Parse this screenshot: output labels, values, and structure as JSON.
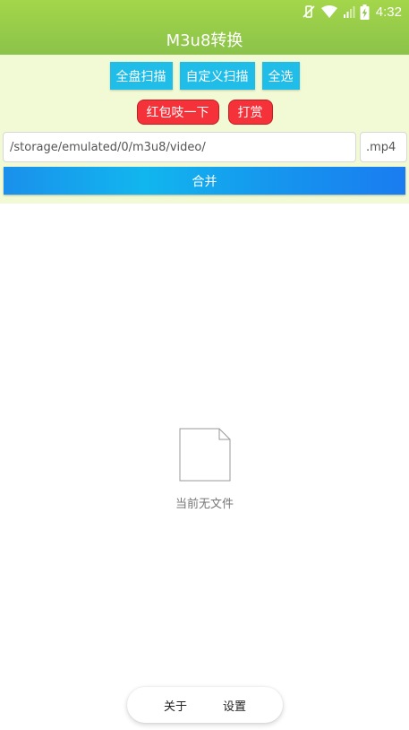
{
  "status_bar": {
    "time": "4:32",
    "icons": [
      "mute-vibrate-icon",
      "wifi-icon",
      "signal-icon",
      "battery-charging-icon"
    ]
  },
  "app": {
    "title": "M3u8转换"
  },
  "toolbar": {
    "scan_all_label": "全盘扫描",
    "custom_scan_label": "自定义扫描",
    "select_all_label": "全选",
    "red_packet_label": "红包吱一下",
    "tip_label": "打赏"
  },
  "path": {
    "value": "/storage/emulated/0/m3u8/video/",
    "extension": ".mp4"
  },
  "merge": {
    "label": "合并"
  },
  "empty_state": {
    "icon": "file-icon",
    "label": "当前无文件"
  },
  "bottom_nav": {
    "about_label": "关于",
    "settings_label": "设置"
  },
  "colors": {
    "header_green": "#8bc34a",
    "panel_bg": "#f1fad4",
    "button_blue": "#1fbde8",
    "button_red": "#f5323a"
  }
}
